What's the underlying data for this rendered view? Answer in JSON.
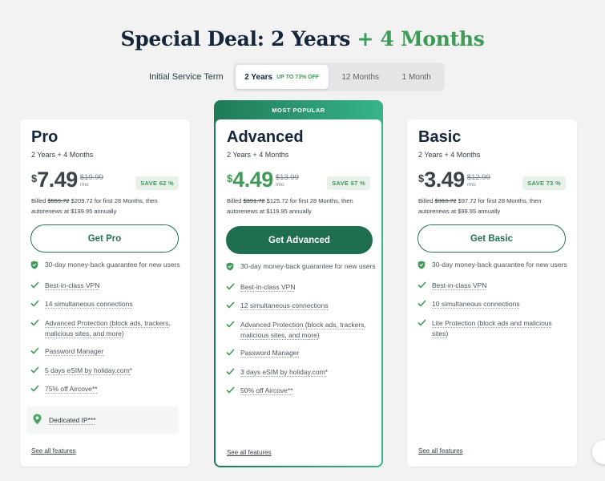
{
  "headline": {
    "main": "Special Deal: 2 Years",
    "plus": "+ 4 Months"
  },
  "term": {
    "label": "Initial Service Term",
    "options": [
      {
        "label": "2 Years",
        "badge": "UP TO 73% OFF",
        "active": true
      },
      {
        "label": "12 Months"
      },
      {
        "label": "1 Month"
      }
    ]
  },
  "featured_banner": "MOST POPULAR",
  "plans": {
    "pro": {
      "name": "Pro",
      "term": "2 Years + 4 Months",
      "currency": "$",
      "price": "7.49",
      "old_price": "$19.99",
      "per": "/mo",
      "save": "SAVE 62 %",
      "billed_prefix": "Billed ",
      "billed_old": "$559.72",
      "billed_rest": " $209.72 for first 28 Months, then autorenews at $199.95 annually",
      "cta": "Get Pro",
      "features": [
        "30-day money-back guarantee for new users",
        "Best-in-class VPN",
        "14 simultaneous connections",
        "Advanced Protection (block ads, trackers, malicious sites, and more)",
        "Password Manager",
        "5 days eSIM by holiday.com*",
        "75% off Aircove**"
      ],
      "dedicated": "Dedicated IP***",
      "see_all": "See all features"
    },
    "advanced": {
      "name": "Advanced",
      "term": "2 Years + 4 Months",
      "currency": "$",
      "price": "4.49",
      "old_price": "$13.99",
      "per": "/mo",
      "save": "SAVE 67 %",
      "billed_prefix": "Billed ",
      "billed_old": "$391.72",
      "billed_rest": " $125.72 for first 28 Months, then autorenews at $119.95 annually",
      "cta": "Get Advanced",
      "features": [
        "30-day money-back guarantee for new users",
        "Best-in-class VPN",
        "12 simultaneous connections",
        "Advanced Protection (block ads, trackers, malicious sites, and more)",
        "Password Manager",
        "3 days eSIM by holiday.com*",
        "50% off Aircove**"
      ],
      "see_all": "See all features"
    },
    "basic": {
      "name": "Basic",
      "term": "2 Years + 4 Months",
      "currency": "$",
      "price": "3.49",
      "old_price": "$12.99",
      "per": "/mo",
      "save": "SAVE 73 %",
      "billed_prefix": "Billed ",
      "billed_old": "$363.72",
      "billed_rest": " $97.72 for first 28 Months, then autorenews at $99.95 annually",
      "cta": "Get Basic",
      "features": [
        "30-day money-back guarantee for new users",
        "Best-in-class VPN",
        "10 simultaneous connections",
        "Lite Protection (block ads and malicious sites)"
      ],
      "see_all": "See all features"
    }
  },
  "colors": {
    "brand_green": "#1f6e4f",
    "accent_green": "#3e9a57",
    "heading": "#15253a"
  }
}
